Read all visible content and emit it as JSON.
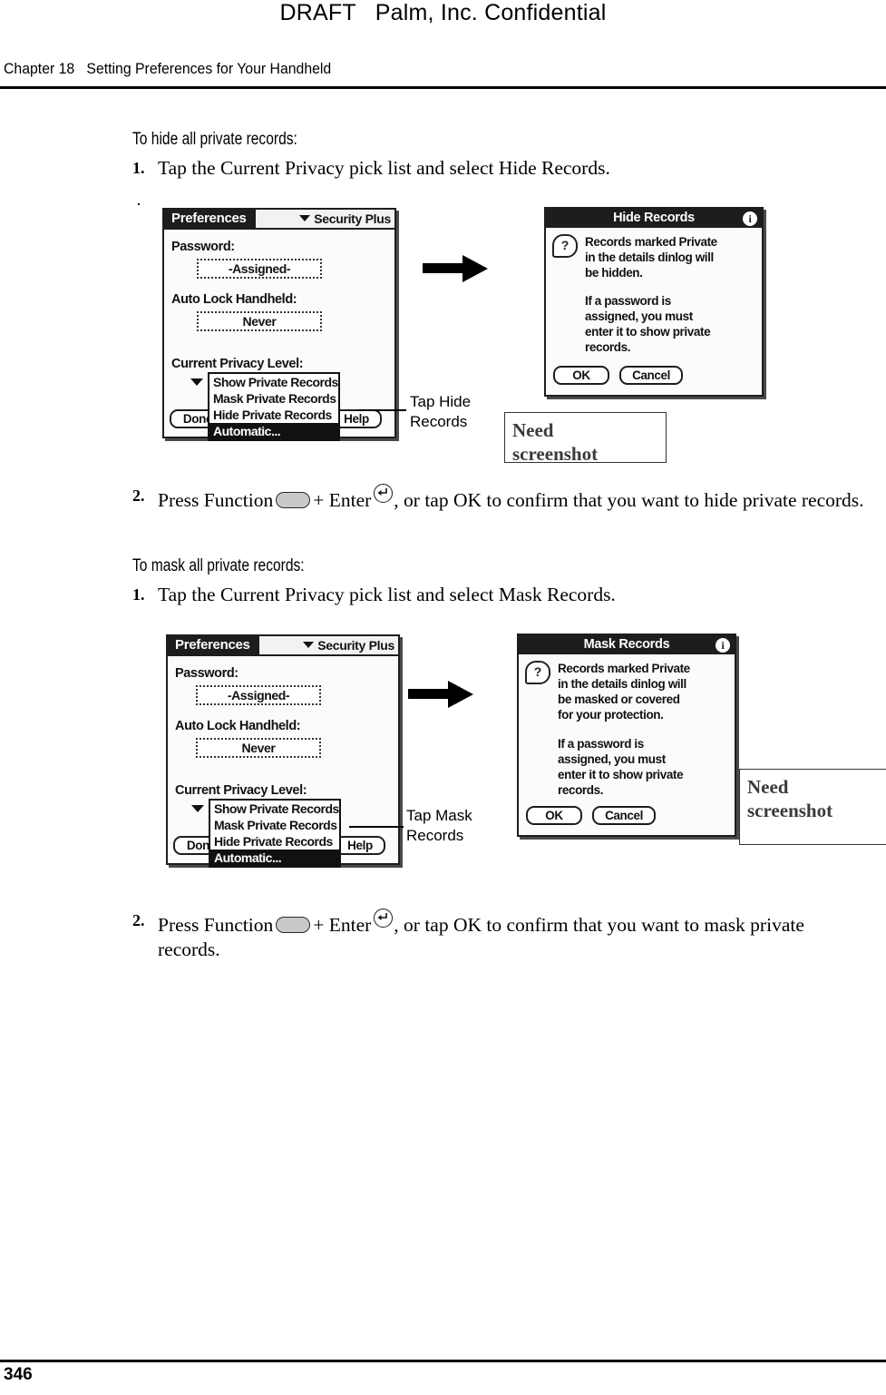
{
  "page": {
    "draft_banner": "DRAFT   Palm, Inc. Confidential",
    "chapter_line": "Chapter 18   Setting Preferences for Your Handheld",
    "page_number": "346"
  },
  "sections": [
    {
      "heading": "To hide all private records:",
      "step1": {
        "number": "1.",
        "text": "Tap the Current Privacy pick list and select Hide Records."
      },
      "step2": {
        "number": "2.",
        "text_before_fn": "Press Function",
        "text_mid": "+ Enter",
        "text_after": ", or tap OK to confirm that you want to hide private records."
      },
      "callout": "Tap Hide\nRecords",
      "need_box": "Need\nscreenshot"
    },
    {
      "heading": "To mask all private records:",
      "step1": {
        "number": "1.",
        "text": "Tap the Current Privacy pick list and select Mask Records."
      },
      "step2": {
        "number": "2.",
        "text_before_fn": "Press Function",
        "text_mid": "+ Enter",
        "text_after": ", or tap OK to confirm that you want to mask private records."
      },
      "callout": "Tap Mask\nRecords",
      "need_box": "Need\nscreenshot"
    }
  ],
  "prefs_screen": {
    "app_title": "Preferences",
    "category": "Security Plus",
    "password_label": "Password:",
    "password_value": "-Assigned-",
    "autolock_label": "Auto Lock Handheld:",
    "autolock_value": "Never",
    "privacy_label": "Current Privacy Level:",
    "pick_items": [
      "Show Private Records",
      "Mask Private Records",
      "Hide Private Records",
      "Automatic..."
    ],
    "selected_index": 3,
    "done_button": "Done",
    "help_button": "Help"
  },
  "hide_dialog": {
    "title": "Hide Records",
    "info_glyph": "i",
    "question_glyph": "?",
    "body_para1": "Records marked Private\nin the details dinlog will\nbe hidden.",
    "body_para2": "If a password is\nassigned, you must\nenter it to show private\nrecords.",
    "ok_button": "OK",
    "cancel_button": "Cancel"
  },
  "mask_dialog": {
    "title": "Mask Records",
    "info_glyph": "i",
    "question_glyph": "?",
    "body_para1": "Records marked Private\nin the details dinlog will\nbe masked or covered\nfor your protection.",
    "body_para2": "If a password is\nassigned, you must\nenter it to show private\nrecords.",
    "ok_button": "OK",
    "cancel_button": "Cancel"
  },
  "colors": {
    "ink": "#000000",
    "paper": "#ffffff",
    "palm_dark": "#1d1d1d",
    "fn_key_gray": "#c9c9c9",
    "need_box_text": "#3a3a3a"
  }
}
